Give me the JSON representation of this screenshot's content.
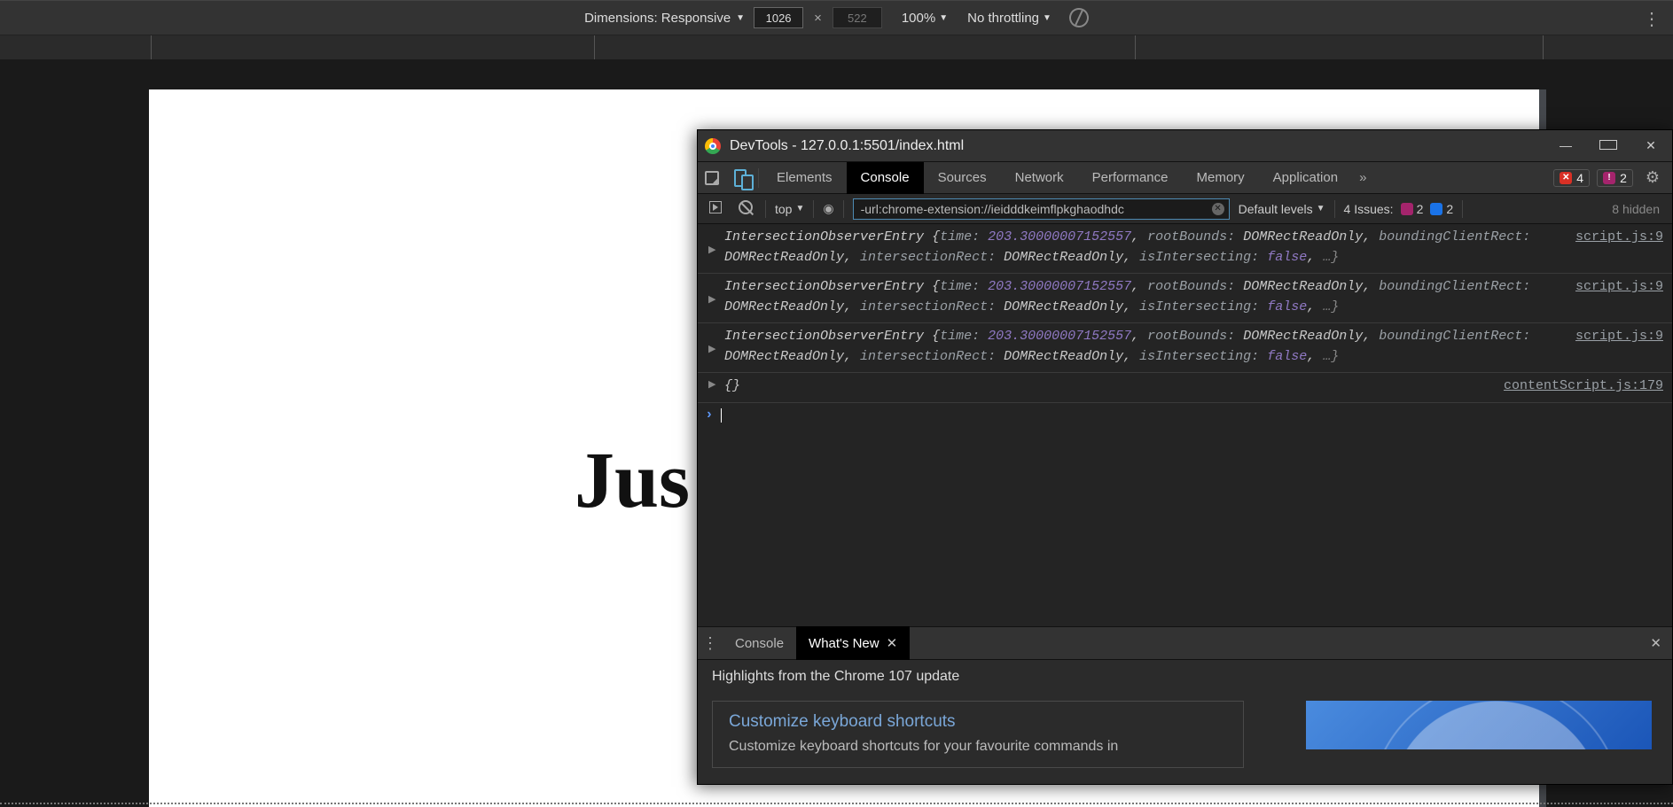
{
  "device_bar": {
    "dimensions_label": "Dimensions: Responsive",
    "width": "1026",
    "height": "522",
    "zoom": "100%",
    "throttling": "No throttling"
  },
  "page": {
    "visible_text": "Jus"
  },
  "devtools": {
    "title": "DevTools - 127.0.0.1:5501/index.html",
    "tabs": [
      "Elements",
      "Console",
      "Sources",
      "Network",
      "Performance",
      "Memory",
      "Application"
    ],
    "active_tab": "Console",
    "error_count": "4",
    "issue_count": "2",
    "console": {
      "context": "top",
      "filter": "-url:chrome-extension://ieidddkeimflpkghaodhdc",
      "levels": "Default levels",
      "issues_label": "4 Issues:",
      "issues_pink": "2",
      "issues_blue": "2",
      "hidden": "8 hidden"
    },
    "messages": [
      {
        "src": "script.js:9",
        "name": "IntersectionObserverEntry",
        "time_key": "time:",
        "time_val": "203.30000007152557",
        "rb_key": "rootBounds:",
        "rb_val": "DOMRectReadOnly",
        "bcr_key": "boundingClientRect:",
        "bcr_val": "DOMRectReadOnly",
        "ir_key": "intersectionRect:",
        "ir_val": "DOMRectReadOnly",
        "ii_key": "isIntersecting:",
        "ii_val": "false"
      },
      {
        "src": "script.js:9",
        "name": "IntersectionObserverEntry",
        "time_key": "time:",
        "time_val": "203.30000007152557",
        "rb_key": "rootBounds:",
        "rb_val": "DOMRectReadOnly",
        "bcr_key": "boundingClientRect:",
        "bcr_val": "DOMRectReadOnly",
        "ir_key": "intersectionRect:",
        "ir_val": "DOMRectReadOnly",
        "ii_key": "isIntersecting:",
        "ii_val": "false"
      },
      {
        "src": "script.js:9",
        "name": "IntersectionObserverEntry",
        "time_key": "time:",
        "time_val": "203.30000007152557",
        "rb_key": "rootBounds:",
        "rb_val": "DOMRectReadOnly",
        "bcr_key": "boundingClientRect:",
        "bcr_val": "DOMRectReadOnly",
        "ir_key": "intersectionRect:",
        "ir_val": "DOMRectReadOnly",
        "ii_key": "isIntersecting:",
        "ii_val": "false"
      }
    ],
    "empty_msg": {
      "src": "contentScript.js:179",
      "body": "{}"
    },
    "drawer": {
      "tabs": [
        "Console",
        "What's New"
      ],
      "active": "What's New",
      "highlights": "Highlights from the Chrome 107 update",
      "card_title": "Customize keyboard shortcuts",
      "card_desc": "Customize keyboard shortcuts for your favourite commands in"
    }
  }
}
